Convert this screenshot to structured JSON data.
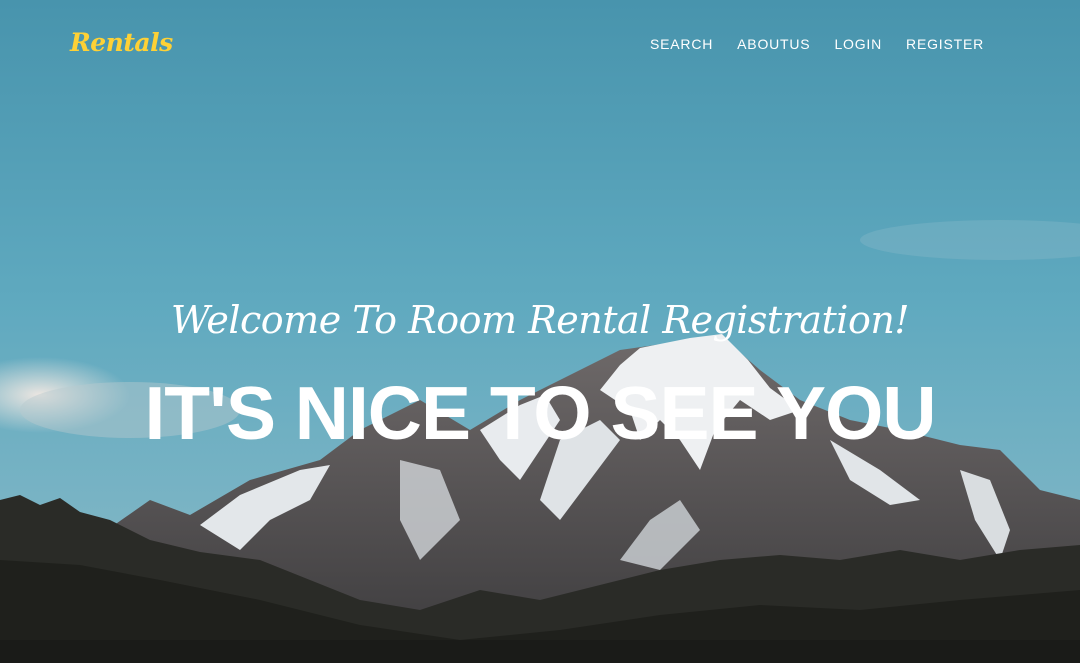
{
  "brand": {
    "name": "Rentals",
    "color": "#fed136"
  },
  "nav": {
    "items": [
      {
        "label": "SEARCH"
      },
      {
        "label": "ABOUTUS"
      },
      {
        "label": "LOGIN"
      },
      {
        "label": "REGISTER"
      }
    ]
  },
  "hero": {
    "lead_in": "Welcome To Room Rental Registration!",
    "heading": "IT'S NICE TO SEE YOU",
    "background": "mountain-sky-photo"
  }
}
